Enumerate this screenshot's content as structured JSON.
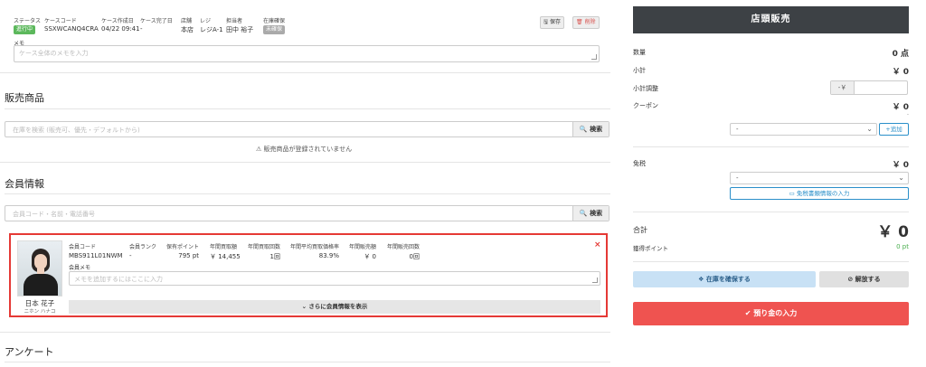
{
  "case": {
    "status_label": "ステータス",
    "status_value": "進行中",
    "status_color": "#5cb85c",
    "code_label": "ケースコード",
    "code_value": "SSXWCANQ4CRA",
    "created_label": "ケース作成日",
    "created_value": "04/22 09:41",
    "completed_label": "ケース完了日",
    "completed_value": "-",
    "store_label": "店舗",
    "store_value": "本店",
    "register_label": "レジ",
    "register_value": "レジA-1",
    "staff_label": "担当者",
    "staff_value": "田中 裕子",
    "stock_label": "在庫確保",
    "stock_value": "未確保",
    "save_label": "保存",
    "delete_label": "削除",
    "memo_label": "メモ",
    "memo_placeholder": "ケース全体のメモを入力"
  },
  "products": {
    "title": "販売商品",
    "search_placeholder": "在庫を検索 (販売可、優先・デフォルトから)",
    "search_button": "検索",
    "empty_message": "販売商品が登録されていません"
  },
  "member": {
    "title": "会員情報",
    "search_placeholder": "会員コード・名前・電話番号",
    "search_button": "検索",
    "name": "日本 花子",
    "kana": "ニホン ハナコ",
    "fields": {
      "code_label": "会員コード",
      "code_value": "MBS911L01NWM",
      "rank_label": "会員ランク",
      "rank_value": "-",
      "points_label": "保有ポイント",
      "points_value": "795 pt",
      "buy_amount_label": "年間買取額",
      "buy_amount_value": "￥ 14,455",
      "buy_count_label": "年間買取回数",
      "buy_count_value": "1回",
      "avg_rate_label": "年間平均買取価格率",
      "avg_rate_value": "83.9%",
      "sale_amount_label": "年間販売額",
      "sale_amount_value": "￥ 0",
      "sale_count_label": "年間販売回数",
      "sale_count_value": "0回"
    },
    "memo_label": "会員メモ",
    "memo_placeholder": "メモを追加するにはここに入力",
    "more_button": "さらに会員情報を表示"
  },
  "survey": {
    "title": "アンケート"
  },
  "pos": {
    "header": "店頭販売",
    "quantity_label": "数量",
    "quantity_value": "0 点",
    "subtotal_label": "小計",
    "subtotal_value": "￥ 0",
    "adjust_label": "小計調整",
    "adjust_prefix": "-￥",
    "coupon_label": "クーポン",
    "coupon_value": "￥ 0",
    "coupon_sub": "-",
    "coupon_select": "-",
    "coupon_add": "追加",
    "tax_free_label": "免税",
    "tax_free_value": "￥ 0",
    "tax_free_select": "-",
    "tax_doc_button": "免税書類情報の入力",
    "total_label": "合計",
    "total_value": "￥ 0",
    "earn_label": "獲得ポイント",
    "earn_value": "0 pt",
    "reserve_button": "在庫を確保する",
    "release_button": "解放する",
    "deposit_button": "預り金の入力"
  },
  "colors": {
    "header_bg": "#3d4145",
    "accent_red": "#ef5350",
    "highlight_border": "#e53935",
    "link_blue": "#2a8fc9",
    "points_green": "#4caf50"
  }
}
